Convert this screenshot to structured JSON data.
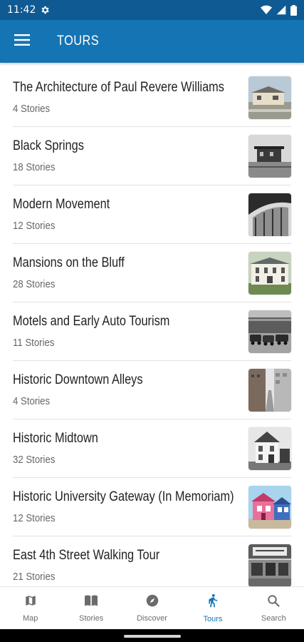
{
  "status": {
    "time": "11:42"
  },
  "header": {
    "title": "TOURS"
  },
  "tours": [
    {
      "title": "The Architecture of Paul Revere Williams",
      "count": "4 Stories",
      "thumb": "house"
    },
    {
      "title": "Black Springs",
      "count": "18 Stories",
      "thumb": "bw-building"
    },
    {
      "title": "Modern Movement",
      "count": "12 Stories",
      "thumb": "modern"
    },
    {
      "title": "Mansions on the Bluff",
      "count": "28 Stories",
      "thumb": "mansion"
    },
    {
      "title": "Motels and Early Auto Tourism",
      "count": "11 Stories",
      "thumb": "cars"
    },
    {
      "title": "Historic Downtown Alleys",
      "count": "4 Stories",
      "thumb": "alley"
    },
    {
      "title": "Historic Midtown",
      "count": "32 Stories",
      "thumb": "midtown"
    },
    {
      "title": "Historic University Gateway (In Memoriam)",
      "count": "12 Stories",
      "thumb": "colorful"
    },
    {
      "title": "East 4th Street Walking Tour",
      "count": "21 Stories",
      "thumb": "storefront"
    }
  ],
  "nav": {
    "items": [
      {
        "label": "Map",
        "icon": "map-icon"
      },
      {
        "label": "Stories",
        "icon": "book-icon"
      },
      {
        "label": "Discover",
        "icon": "compass-icon"
      },
      {
        "label": "Tours",
        "icon": "walking-icon",
        "active": true
      },
      {
        "label": "Search",
        "icon": "search-icon"
      }
    ]
  },
  "colors": {
    "status_bar": "#0f5a93",
    "app_bar": "#1574b3",
    "accent": "#1574b3"
  }
}
